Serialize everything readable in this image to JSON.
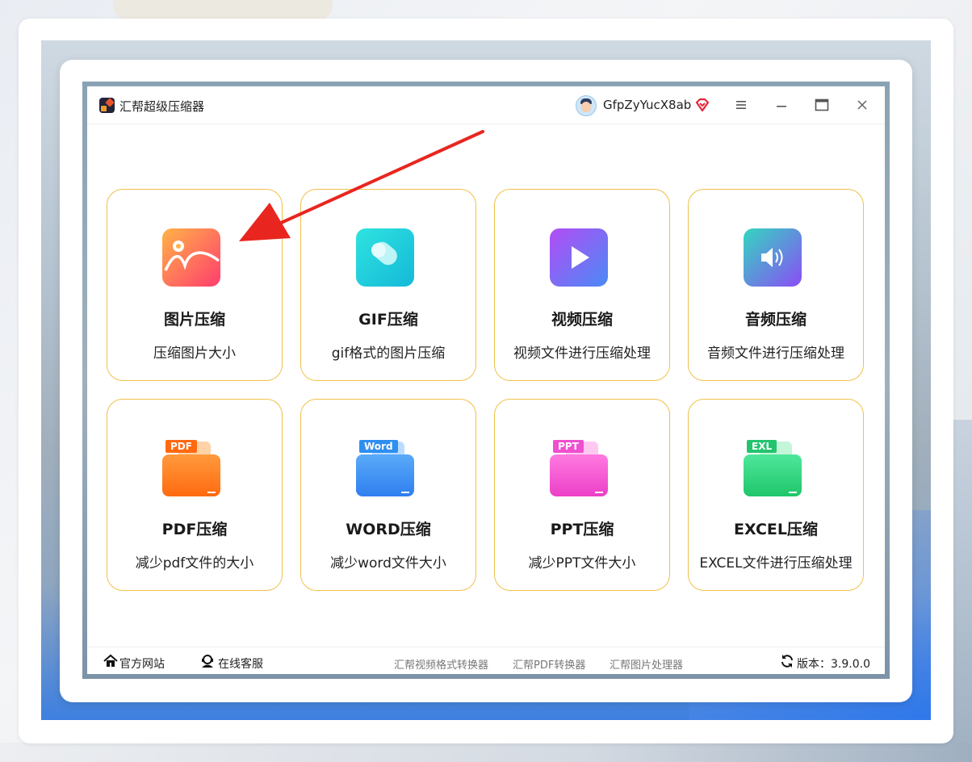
{
  "window": {
    "app_title": "汇帮超级压缩器",
    "username": "GfpZyYucX8ab",
    "menu_icon": "menu-icon",
    "min_icon": "minimize-icon",
    "max_icon": "maximize-icon",
    "close_icon": "close-icon"
  },
  "tools": [
    {
      "title": "图片压缩",
      "subtitle": "压缩图片大小",
      "icon": "image-icon"
    },
    {
      "title": "GIF压缩",
      "subtitle": "gif格式的图片压缩",
      "icon": "gif-icon"
    },
    {
      "title": "视频压缩",
      "subtitle": "视频文件进行压缩处理",
      "icon": "video-play-icon"
    },
    {
      "title": "音频压缩",
      "subtitle": "音频文件进行压缩处理",
      "icon": "audio-speaker-icon"
    },
    {
      "title": "PDF压缩",
      "subtitle": "减少pdf文件的大小",
      "icon": "pdf-folder-icon",
      "tag": "PDF"
    },
    {
      "title": "WORD压缩",
      "subtitle": "减少word文件大小",
      "icon": "word-folder-icon",
      "tag": "Word"
    },
    {
      "title": "PPT压缩",
      "subtitle": "减少PPT文件大小",
      "icon": "ppt-folder-icon",
      "tag": "PPT"
    },
    {
      "title": "EXCEL压缩",
      "subtitle": "EXCEL文件进行压缩处理",
      "icon": "excel-folder-icon",
      "tag": "EXL"
    }
  ],
  "statusbar": {
    "official_site": "官方网站",
    "online_service": "在线客服",
    "link1": "汇帮视频格式转换器",
    "link2": "汇帮PDF转换器",
    "link3": "汇帮图片处理器",
    "version": "版本：3.9.0.0"
  },
  "colors": {
    "card_border": "#f0c14a",
    "arrow": "#e8261f",
    "pdf": "#ff7a1a",
    "word": "#3b8ef0",
    "ppt": "#f04fd0",
    "excel": "#2fd17a"
  }
}
